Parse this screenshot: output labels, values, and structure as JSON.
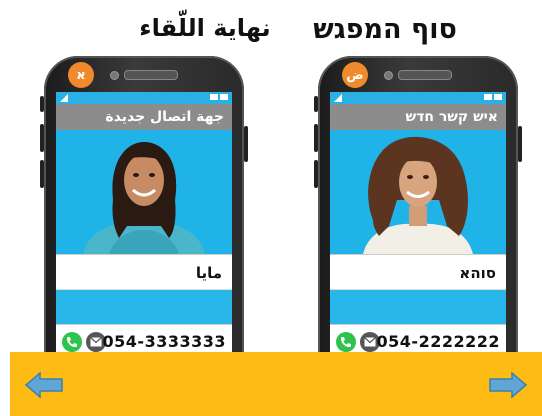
{
  "titles": {
    "hebrew": "סוף המפגש",
    "arabic": "نهاية اللّقاء"
  },
  "phones": {
    "left": {
      "avatar_letter": "א",
      "header": "جهة اتصال جديدة",
      "contact_name": "مايا",
      "phone_number": "054-3333333"
    },
    "right": {
      "avatar_letter": "ض",
      "header": "איש קשר חדש",
      "contact_name": "סוהא",
      "phone_number": "054-2222222"
    }
  },
  "navigation": {
    "prev_icon": "arrow-left-icon",
    "next_icon": "arrow-right-icon"
  },
  "colors": {
    "screen_blue": "#29b6e8",
    "header_gray": "#8c8c8c",
    "avatar_orange": "#f08a2c",
    "bottom_bar": "#fdbb13",
    "arrow_blue": "#5fa6d6",
    "call_green": "#2ec24e"
  }
}
